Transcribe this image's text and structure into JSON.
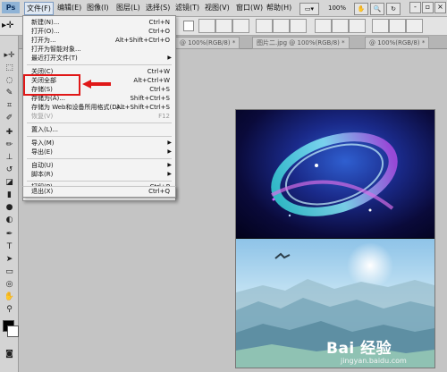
{
  "app": {
    "logo": "Ps"
  },
  "menubar": {
    "items": [
      "文件(F)",
      "编辑(E)",
      "图像(I)",
      "图层(L)",
      "选择(S)",
      "滤镜(T)",
      "视图(V)",
      "窗口(W)",
      "帮助(H)"
    ],
    "zoom": "100%"
  },
  "tabs": [
    {
      "label": "@ 100%(RGB/8) *"
    },
    {
      "label": "@ 100%(RGB/8) *"
    },
    {
      "label": "图片二.jpg @ 100%(RGB/8) *"
    },
    {
      "label": "@ 100%(RGB/8) *"
    }
  ],
  "file_menu": {
    "items": [
      {
        "label": "新建(N)...",
        "shortcut": "Ctrl+N"
      },
      {
        "label": "打开(O)...",
        "shortcut": "Ctrl+O"
      },
      {
        "label": "打开为...",
        "shortcut": "Alt+Shift+Ctrl+O"
      },
      {
        "label": "打开为智能对象...",
        "shortcut": ""
      },
      {
        "label": "最近打开文件(T)",
        "shortcut": ""
      },
      {
        "label": "关闭(C)",
        "shortcut": "Ctrl+W"
      },
      {
        "label": "关闭全部",
        "shortcut": "Alt+Ctrl+W"
      },
      {
        "label": "存储(S)",
        "shortcut": "Ctrl+S"
      },
      {
        "label": "存储为(A)...",
        "shortcut": "Shift+Ctrl+S"
      },
      {
        "label": "存储为 Web和设备所用格式(D)...",
        "shortcut": "Alt+Shift+Ctrl+S"
      },
      {
        "label": "恢复(V)",
        "shortcut": "F12"
      },
      {
        "label": "置入(L)...",
        "shortcut": ""
      },
      {
        "label": "导入(M)",
        "shortcut": ""
      },
      {
        "label": "导出(E)",
        "shortcut": ""
      },
      {
        "label": "自动(U)",
        "shortcut": ""
      },
      {
        "label": "脚本(R)",
        "shortcut": ""
      },
      {
        "label": "打印(P)...",
        "shortcut": "Ctrl+P"
      },
      {
        "label": "打印一份(Y)",
        "shortcut": "Alt+Shift+Ctrl+P"
      },
      {
        "label": "退出(X)",
        "shortcut": "Ctrl+Q"
      }
    ]
  },
  "watermark": {
    "main": "Bai 经验",
    "sub": "jingyan.baidu.com"
  },
  "colors": {
    "highlight": "#e01818",
    "menu_active": "#dfe8f3"
  }
}
